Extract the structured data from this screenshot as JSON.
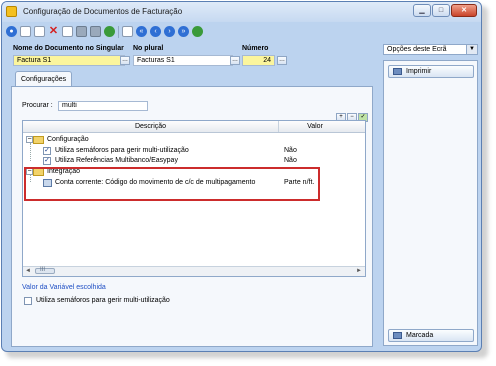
{
  "window": {
    "title": "Configuração de Documentos de Facturação"
  },
  "header": {
    "singular_label": "Nome do Documento no Singular",
    "singular_value": "Factura S1",
    "plural_label": "No plural",
    "plural_value": "Facturas S1",
    "number_label": "Número",
    "number_value": "24"
  },
  "tabs": [
    {
      "label": "Configurações"
    }
  ],
  "search": {
    "label": "Procurar :",
    "value": "multi"
  },
  "grid": {
    "columns": [
      "Descrição",
      "Valor"
    ],
    "groups": [
      {
        "label": "Configuração",
        "items": [
          {
            "label": "Utiliza semáforos para gerir multi-utilização",
            "value": "Não"
          },
          {
            "label": "Utiliza Referências Multibanco/Easypay",
            "value": "Não"
          }
        ]
      },
      {
        "label": "Integração",
        "items": [
          {
            "label": "Conta corrente: Código do movimento de c/c de multipagamento",
            "value": "Parte n/ft."
          }
        ]
      }
    ],
    "scroll_left": "◄",
    "scroll_right": "►",
    "scroll_thumb": "III"
  },
  "footer": {
    "variable_title": "Valor da Variável escolhida",
    "checkbox_label": "Utiliza semáforos para gerir multi-utilização"
  },
  "sidebar": {
    "screen_options": "Opções deste Ecrã",
    "print_button": "Imprimir",
    "bookmark_button": "Marcada"
  },
  "colors": {
    "highlight_box": "#cc2c2c",
    "mandatory_field": "#fbf59d",
    "link_text": "#1f4fc4"
  }
}
